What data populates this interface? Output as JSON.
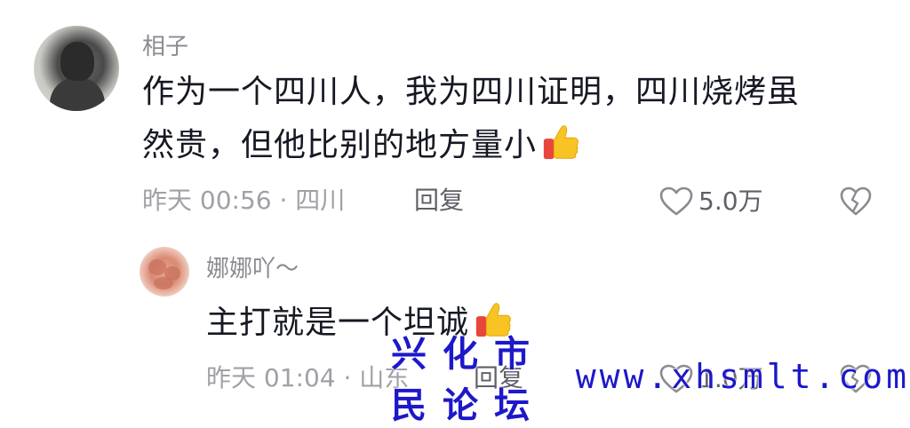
{
  "comments": [
    {
      "username": "相子",
      "text_line1": "作为一个四川人，我为四川证明，四川烧烤虽",
      "text_line2": "然贵，但他比别的地方量小",
      "meta": "昨天 00:56 · 四川",
      "reply_label": "回复",
      "likes": "5.0万"
    }
  ],
  "replies": [
    {
      "username": "娜娜吖～",
      "text": "主打就是一个坦诚",
      "meta": "昨天 01:04 · 山东",
      "reply_label": "回复",
      "likes": "1.0万"
    }
  ],
  "watermark": {
    "site_name": "兴化市民论坛",
    "url": "www.xhsmlt.com"
  },
  "icons": {
    "emoji": "thumbs-up-icon",
    "like": "heart-outline-icon",
    "dislike": "broken-heart-icon"
  },
  "colors": {
    "username": "#8a8b91",
    "text": "#161823",
    "meta": "#a0a1a6",
    "action": "#5f6069",
    "watermark": "#1d18c9"
  }
}
